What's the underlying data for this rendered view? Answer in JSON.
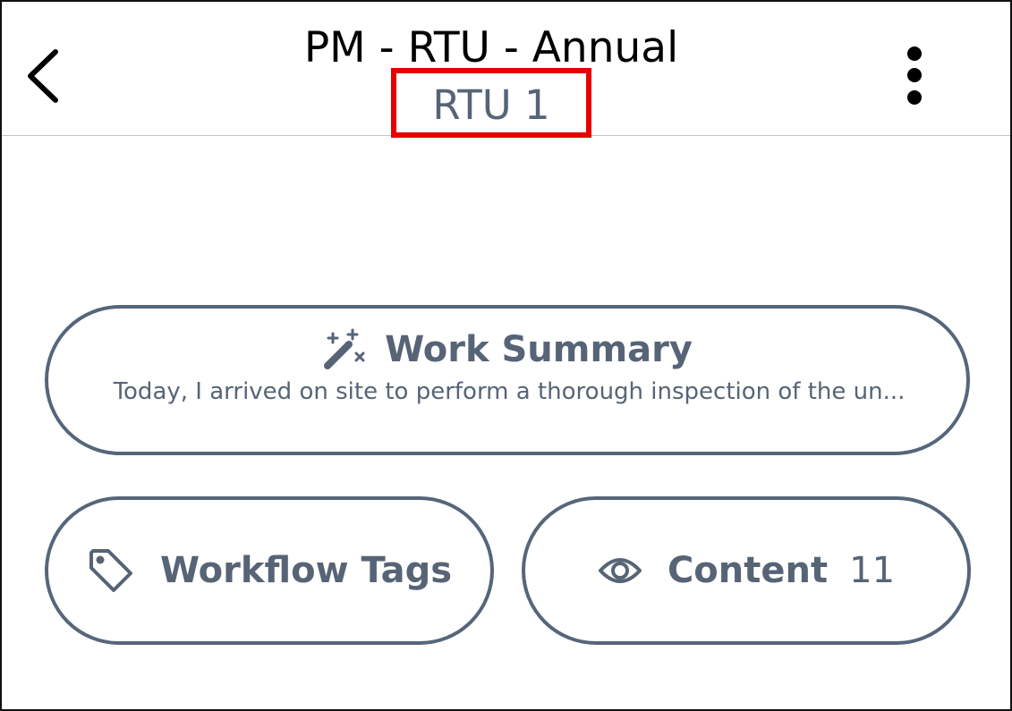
{
  "header": {
    "title": "PM - RTU - Annual",
    "subtitle": "RTU 1",
    "back_icon": "chevron-left-icon",
    "more_icon": "more-vertical-icon"
  },
  "work_summary": {
    "title": "Work Summary",
    "text": "Today, I arrived on site to perform a thorough inspection of the un...",
    "icon": "magic-wand-icon"
  },
  "workflow_tags": {
    "label": "Workflow Tags",
    "icon": "tag-icon"
  },
  "content": {
    "label": "Content",
    "count": "11",
    "icon": "eye-icon"
  },
  "colors": {
    "accent": "#566476",
    "highlight": "#e60000",
    "title": "#000000",
    "divider": "#c4c4c4"
  }
}
